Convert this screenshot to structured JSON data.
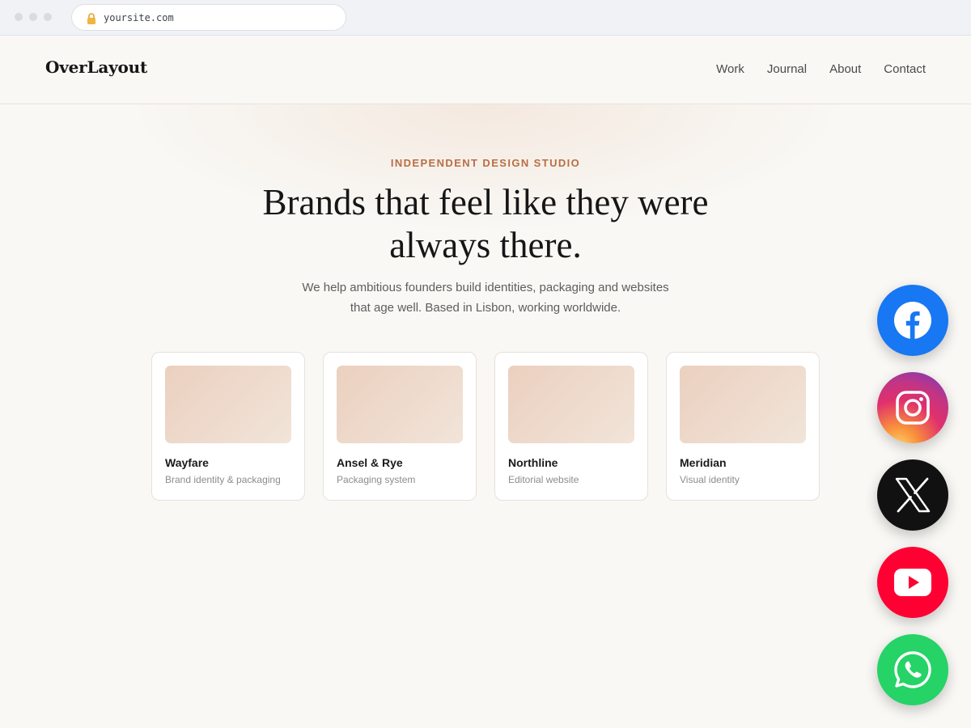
{
  "browser": {
    "url": "yoursite.com"
  },
  "header": {
    "logo": "OverLayout",
    "nav": [
      {
        "label": "Work"
      },
      {
        "label": "Journal"
      },
      {
        "label": "About"
      },
      {
        "label": "Contact"
      }
    ]
  },
  "hero": {
    "eyebrow": "INDEPENDENT DESIGN STUDIO",
    "headline": "Brands that feel like they were always there.",
    "subtext": "We help ambitious founders build identities, packaging and websites that age well. Based in Lisbon, working worldwide."
  },
  "projects": [
    {
      "title": "Wayfare",
      "subtitle": "Brand identity & packaging"
    },
    {
      "title": "Ansel & Rye",
      "subtitle": "Packaging system"
    },
    {
      "title": "Northline",
      "subtitle": "Editorial website"
    },
    {
      "title": "Meridian",
      "subtitle": "Visual identity"
    }
  ],
  "social_buttons": [
    {
      "icon": "facebook-icon",
      "color": "#1877f2"
    },
    {
      "icon": "instagram-icon",
      "color": "#d62976"
    },
    {
      "icon": "x-icon",
      "color": "#111111"
    },
    {
      "icon": "youtube-icon",
      "color": "#ff0033"
    },
    {
      "icon": "whatsapp-icon",
      "color": "#25d366"
    }
  ],
  "colors": {
    "accent": "#b76e45",
    "background": "#f9f8f5"
  }
}
